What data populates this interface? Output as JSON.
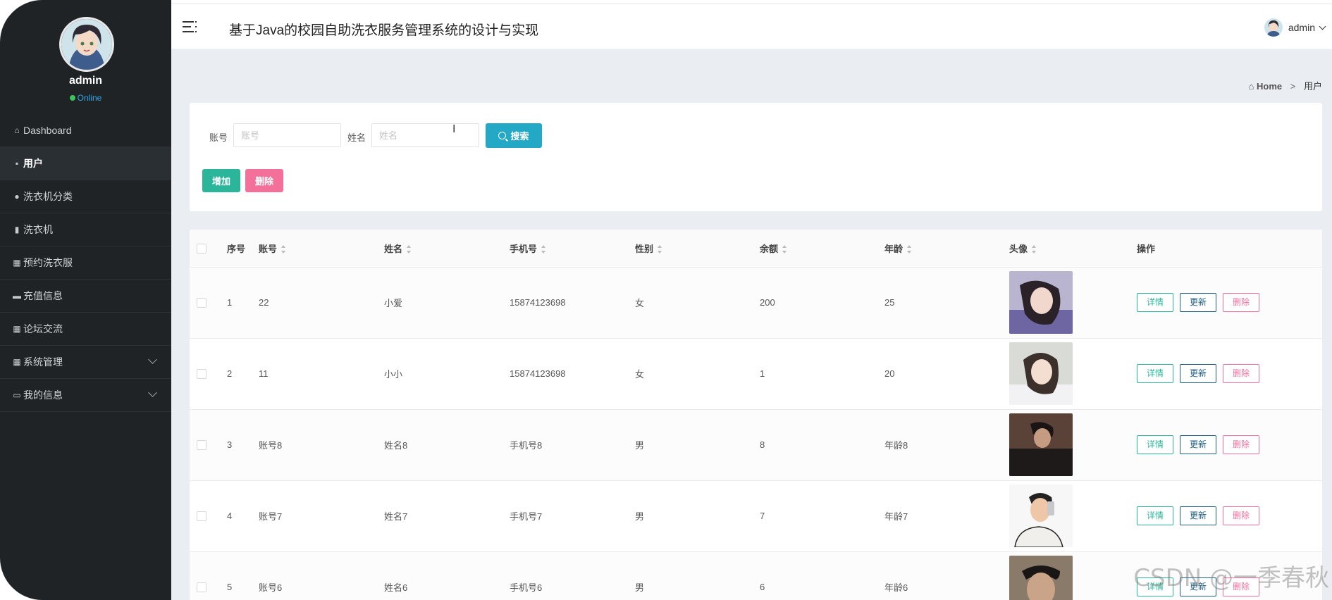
{
  "sidebar": {
    "user": {
      "name": "admin",
      "status": "Online"
    },
    "items": [
      {
        "label": "Dashboard",
        "icon": "home-icon",
        "glyph": "⌂"
      },
      {
        "label": "用户",
        "icon": "user-icon",
        "glyph": "▪",
        "active": true
      },
      {
        "label": "洗衣机分类",
        "icon": "pin-icon",
        "glyph": "●"
      },
      {
        "label": "洗衣机",
        "icon": "library-icon",
        "glyph": "▮"
      },
      {
        "label": "预约洗衣服",
        "icon": "grid-icon",
        "glyph": "▦"
      },
      {
        "label": "充值信息",
        "icon": "bank-icon",
        "glyph": "▬"
      },
      {
        "label": "论坛交流",
        "icon": "grid-icon",
        "glyph": "▦"
      },
      {
        "label": "系统管理",
        "icon": "grid-icon",
        "glyph": "▦",
        "expandable": true
      },
      {
        "label": "我的信息",
        "icon": "card-icon",
        "glyph": "▭",
        "expandable": true
      }
    ]
  },
  "header": {
    "title": "基于Java的校园自助洗衣服务管理系统的设计与实现",
    "user": "admin"
  },
  "breadcrumb": {
    "home": "Home",
    "separator": ">",
    "current": "用户"
  },
  "search": {
    "account_label": "账号",
    "account_placeholder": "账号",
    "name_label": "姓名",
    "name_placeholder": "姓名",
    "search_button": "搜索"
  },
  "actions": {
    "add": "增加",
    "delete": "删除"
  },
  "table": {
    "columns": [
      "序号",
      "账号",
      "姓名",
      "手机号",
      "性别",
      "余额",
      "年龄",
      "头像",
      "操作"
    ],
    "rows": [
      {
        "no": "1",
        "account": "22",
        "name": "小爱",
        "phone": "15874123698",
        "gender": "女",
        "balance": "200",
        "age": "25"
      },
      {
        "no": "2",
        "account": "11",
        "name": "小小",
        "phone": "15874123698",
        "gender": "女",
        "balance": "1",
        "age": "20"
      },
      {
        "no": "3",
        "account": "账号8",
        "name": "姓名8",
        "phone": "手机号8",
        "gender": "男",
        "balance": "8",
        "age": "年龄8"
      },
      {
        "no": "4",
        "account": "账号7",
        "name": "姓名7",
        "phone": "手机号7",
        "gender": "男",
        "balance": "7",
        "age": "年龄7"
      },
      {
        "no": "5",
        "account": "账号6",
        "name": "姓名6",
        "phone": "手机号6",
        "gender": "男",
        "balance": "6",
        "age": "年龄6"
      }
    ],
    "row_actions": {
      "detail": "详情",
      "update": "更新",
      "delete": "删除"
    }
  },
  "watermark": "CSDN @一季春秋",
  "colors": {
    "sidebar_bg": "#1f2326",
    "search_btn": "#23a8c6",
    "add_btn": "#2bb59b",
    "delete_btn": "#f3709a",
    "online": "#3cc35a"
  }
}
